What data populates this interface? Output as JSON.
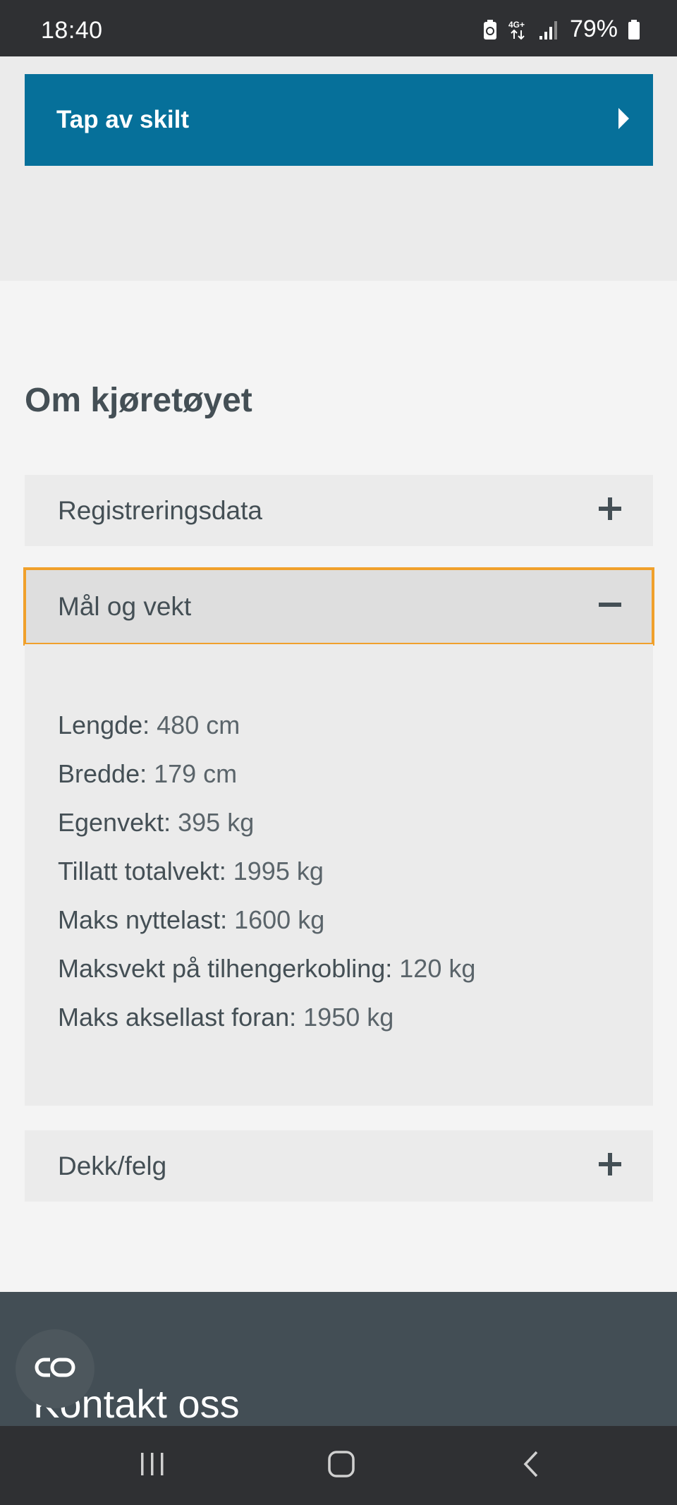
{
  "status_bar": {
    "time": "18:40",
    "network": "4G+",
    "battery": "79%",
    "icons": [
      "battery-saver-icon",
      "network-4g-icon",
      "signal-icon",
      "battery-icon"
    ]
  },
  "top_button": {
    "label": "Tap av skilt",
    "icon": "chevron-right-icon"
  },
  "section": {
    "title": "Om kjøretøyet"
  },
  "accordions": [
    {
      "label": "Registreringsdata",
      "state": "collapsed",
      "icon": "plus-icon"
    },
    {
      "label": "Mål og vekt",
      "state": "expanded",
      "icon": "minus-icon"
    },
    {
      "label": "Dekk/felg",
      "state": "collapsed",
      "icon": "plus-icon"
    }
  ],
  "specs": [
    {
      "key": "Lengde:",
      "value": "480 cm"
    },
    {
      "key": "Bredde:",
      "value": "179 cm"
    },
    {
      "key": "Egenvekt:",
      "value": "395 kg"
    },
    {
      "key": "Tillatt totalvekt:",
      "value": "1995 kg"
    },
    {
      "key": "Maks nyttelast:",
      "value": "1600 kg"
    },
    {
      "key": "Maksvekt på tilhengerkobling:",
      "value": "120 kg"
    },
    {
      "key": "Maks aksellast foran:",
      "value": "1950 kg"
    }
  ],
  "footer": {
    "title": "Kontakt oss"
  },
  "colors": {
    "accent": "#06709a",
    "focus": "#f0a02b",
    "footer": "#434e55",
    "text": "#444f55"
  },
  "nav": [
    "recent-apps-icon",
    "home-icon",
    "back-icon"
  ]
}
